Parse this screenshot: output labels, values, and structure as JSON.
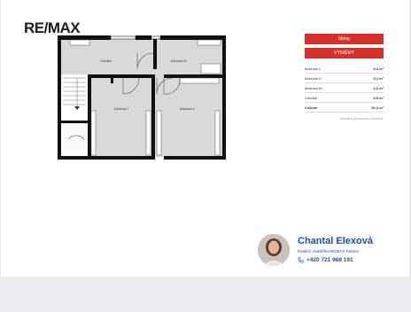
{
  "brand": {
    "logo_text": "RE/MAX"
  },
  "plan": {
    "rooms": {
      "chodba": "Chodba",
      "mistnost_ii": "Místnost III",
      "mistnost_i": "Místnost I",
      "mistnost_ii_lower": "Místnost II"
    }
  },
  "panel": {
    "floor_button": "Sklep",
    "areas_button": "VÝMĚRY",
    "rows": [
      {
        "label": "Místnost I.",
        "value": "6,3 m²"
      },
      {
        "label": "Místnost II.",
        "value": "5,3 m²"
      },
      {
        "label": "Místnost III.",
        "value": "2,2 m²"
      },
      {
        "label": "Chodba",
        "value": "6,5 m²"
      },
      {
        "label": "Celkem",
        "value": "20,3 m²"
      }
    ],
    "note": "Rozměry jsou pouze orientační"
  },
  "agent": {
    "name": "Chantal Elexová",
    "role": "Realitní makléřka RE/MAX Partner",
    "phone": "+420 721 968 191"
  },
  "colors": {
    "accent_red": "#d9302b",
    "agent_blue": "#1e4ea3",
    "wall": "#111111",
    "floor": "#d9d9d9"
  }
}
